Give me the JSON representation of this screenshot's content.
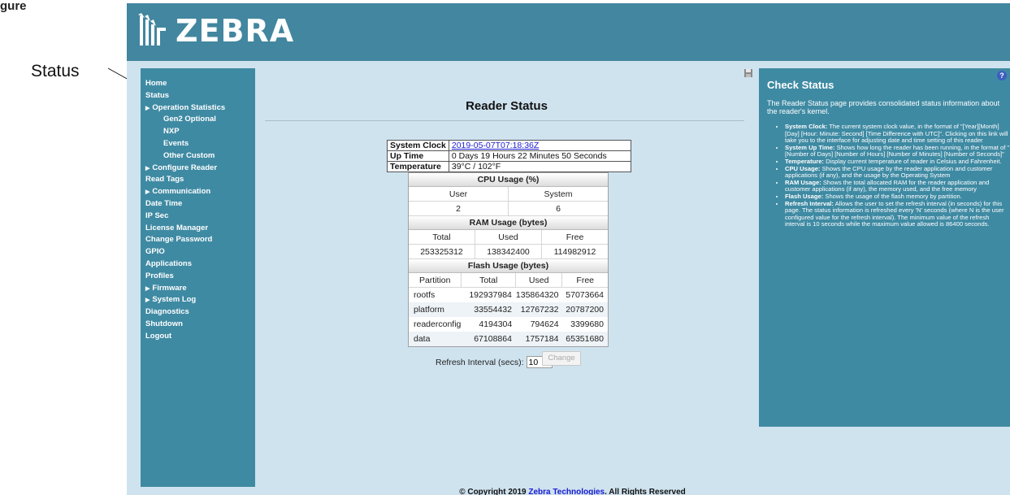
{
  "figure": {
    "caption": "gure"
  },
  "callout": {
    "label": "Status"
  },
  "header": {
    "logo_text": "ZEBRA",
    "color": "#42869f"
  },
  "sidebar": {
    "items": [
      {
        "label": "Home",
        "sub": false,
        "caret": false
      },
      {
        "label": "Status",
        "sub": false,
        "caret": false
      },
      {
        "label": "Operation Statistics",
        "sub": false,
        "caret": true
      },
      {
        "label": "Gen2 Optional",
        "sub": true,
        "caret": false
      },
      {
        "label": "NXP",
        "sub": true,
        "caret": false
      },
      {
        "label": "Events",
        "sub": true,
        "caret": false
      },
      {
        "label": "Other Custom",
        "sub": true,
        "caret": false
      },
      {
        "label": "Configure Reader",
        "sub": false,
        "caret": true
      },
      {
        "label": "Read Tags",
        "sub": false,
        "caret": false
      },
      {
        "label": "Communication",
        "sub": false,
        "caret": true
      },
      {
        "label": "Date Time",
        "sub": false,
        "caret": false
      },
      {
        "label": "IP Sec",
        "sub": false,
        "caret": false
      },
      {
        "label": "License Manager",
        "sub": false,
        "caret": false
      },
      {
        "label": "Change Password",
        "sub": false,
        "caret": false
      },
      {
        "label": "GPIO",
        "sub": false,
        "caret": false
      },
      {
        "label": "Applications",
        "sub": false,
        "caret": false
      },
      {
        "label": "Profiles",
        "sub": false,
        "caret": false
      },
      {
        "label": "Firmware",
        "sub": false,
        "caret": true
      },
      {
        "label": "System Log",
        "sub": false,
        "caret": true
      },
      {
        "label": "Diagnostics",
        "sub": false,
        "caret": false
      },
      {
        "label": "Shutdown",
        "sub": false,
        "caret": false
      },
      {
        "label": "Logout",
        "sub": false,
        "caret": false
      }
    ]
  },
  "main": {
    "title": "Reader Status",
    "system_clock_label": "System Clock",
    "system_clock_value": "2019-05-07T07:18:36Z",
    "uptime_label": "Up Time",
    "uptime_value": "0 Days 19 Hours 22 Minutes 50 Seconds",
    "temperature_label": "Temperature",
    "temperature_value": "39°C / 102°F",
    "cpu": {
      "title": "CPU Usage (%)",
      "headers": [
        "User",
        "System"
      ],
      "values": [
        "2",
        "6"
      ]
    },
    "ram": {
      "title": "RAM Usage (bytes)",
      "headers": [
        "Total",
        "Used",
        "Free"
      ],
      "values": [
        "253325312",
        "138342400",
        "114982912"
      ]
    },
    "flash": {
      "title": "Flash Usage (bytes)",
      "headers": [
        "Partition",
        "Total",
        "Used",
        "Free"
      ],
      "rows": [
        [
          "rootfs",
          "192937984",
          "135864320",
          "57073664"
        ],
        [
          "platform",
          "33554432",
          "12767232",
          "20787200"
        ],
        [
          "readerconfig",
          "4194304",
          "794624",
          "3399680"
        ],
        [
          "data",
          "67108864",
          "1757184",
          "65351680"
        ]
      ]
    },
    "refresh_label": "Refresh Interval (secs):",
    "refresh_value": "10",
    "change_label": "Change"
  },
  "help": {
    "title": "Check Status",
    "intro": "The Reader Status page provides consolidated status information about the reader's kernel.",
    "items": [
      {
        "term": "System Clock:",
        "text": "The current system clock value, in the format of \"[Year][Month] [Day] [Hour: Minute: Second] [Time Difference with UTC]\". Clicking on this link will take you to the interface for adjusting date and time setting of this reader"
      },
      {
        "term": "System Up Time:",
        "text": "Shows  how long the reader has been running, in the format of \"[Number of Days] [Number of Hours] [Number of Minutes] [Number of Seconds]\""
      },
      {
        "term": "Temperature:",
        "text": "Display current temperature of reader in Celsius and Fahrenheit."
      },
      {
        "term": "CPU Usage:",
        "text": "Shows the CPU usage by the reader application and customer applications (if any), and the usage by the Operating System"
      },
      {
        "term": "RAM Usage:",
        "text": "Shows the total allocated RAM for the reader application and customer applications (if any), the memory used, and the free memory"
      },
      {
        "term": "Flash Usage:",
        "text": "Shows the usage of the flash memory by partition."
      },
      {
        "term": "Refresh Interval:",
        "text": "Allows the user to set the refresh interval (in seconds) for this page. The status information is refreshed every 'N' seconds (where N is the user configured value for the refresh interval). The minimum value of the refresh interval is 10 seconds while the maximum value allowed is 86400 seconds."
      }
    ]
  },
  "footer": {
    "prefix": "© Copyright 2019 ",
    "link": "Zebra Technologies",
    "suffix": ". All Rights Reserved"
  }
}
